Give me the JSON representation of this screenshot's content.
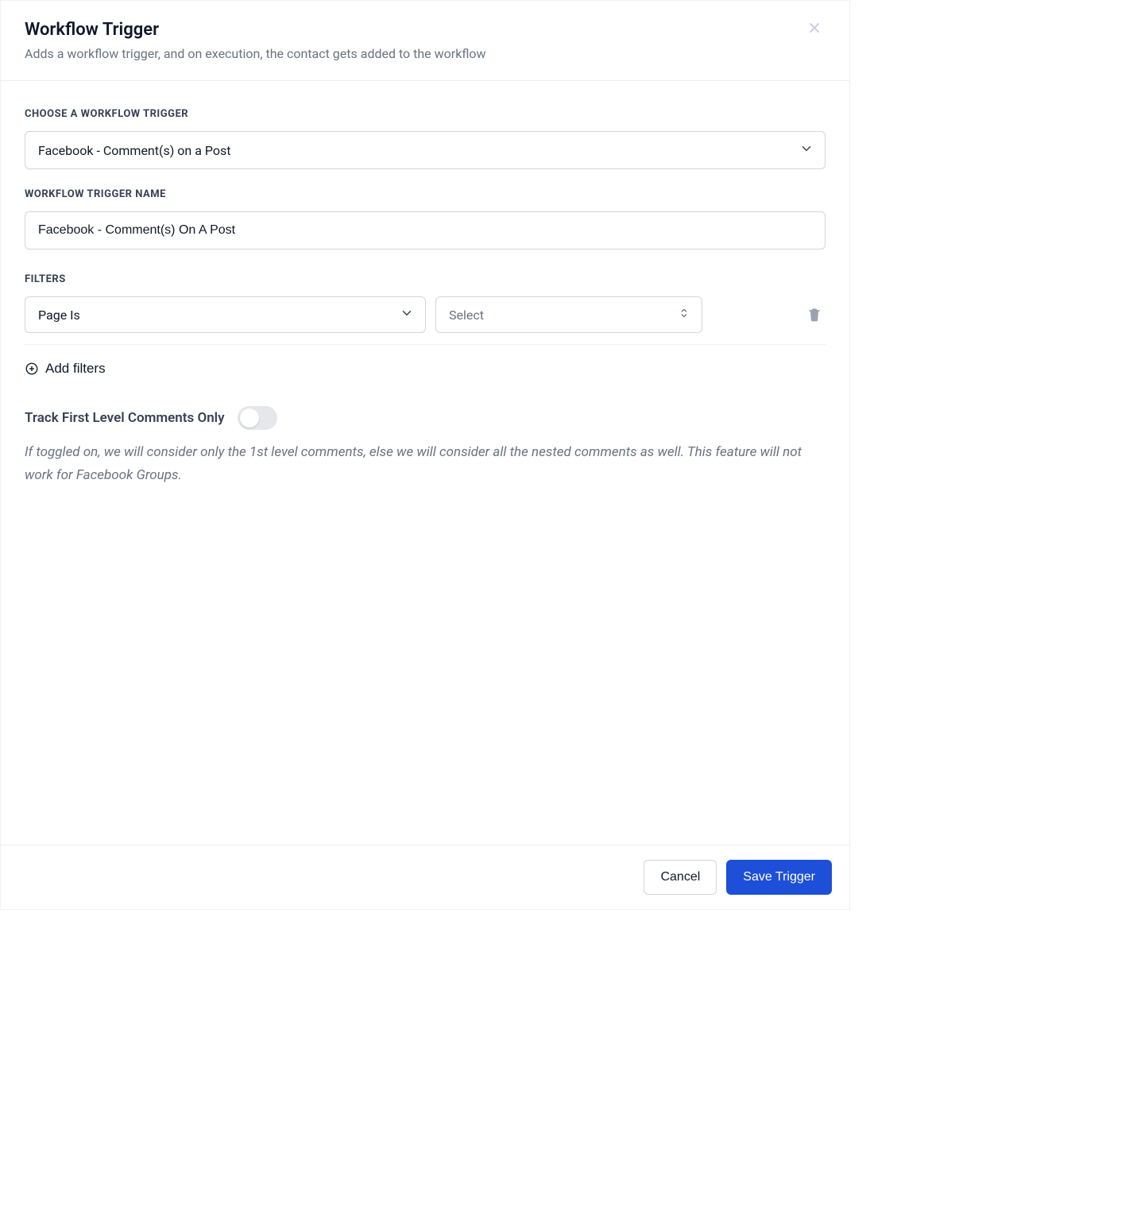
{
  "header": {
    "title": "Workflow Trigger",
    "subtitle": "Adds a workflow trigger, and on execution, the contact gets added to the workflow"
  },
  "labels": {
    "choose_trigger": "CHOOSE A WORKFLOW TRIGGER",
    "trigger_name": "WORKFLOW TRIGGER NAME",
    "filters": "FILTERS"
  },
  "trigger": {
    "selected": "Facebook - Comment(s) on a Post",
    "name_value": "Facebook - Comment(s) On A Post"
  },
  "filters_row": {
    "field_selected": "Page Is",
    "value_placeholder": "Select"
  },
  "add_filters_label": "Add filters",
  "toggle": {
    "label": "Track First Level Comments Only",
    "state": false,
    "help": "If toggled on, we will consider only the 1st level comments, else we will consider all the nested comments as well. This feature will not work for Facebook Groups."
  },
  "footer": {
    "cancel": "Cancel",
    "save": "Save Trigger"
  }
}
